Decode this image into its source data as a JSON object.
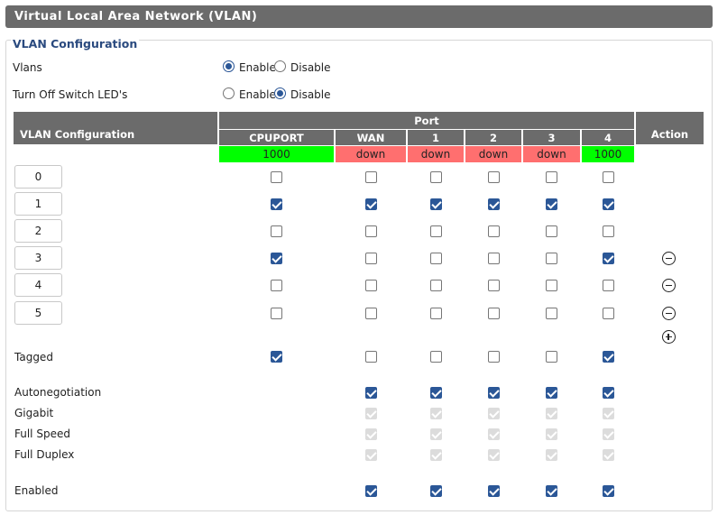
{
  "title": "Virtual Local Area Network (VLAN)",
  "section_legend": "VLAN Configuration",
  "settings": {
    "vlans": {
      "label": "Vlans",
      "enable_label": "Enable",
      "disable_label": "Disable",
      "selected": "enable"
    },
    "leds": {
      "label": "Turn Off Switch LED's",
      "enable_label": "Enable",
      "disable_label": "Disable",
      "selected": "disable"
    }
  },
  "table": {
    "vlan_header": "VLAN Configuration",
    "port_header": "Port",
    "action_header": "Action",
    "ports": [
      {
        "name": "CPUPORT",
        "status": "1000"
      },
      {
        "name": "WAN",
        "status": "down"
      },
      {
        "name": "1",
        "status": "down"
      },
      {
        "name": "2",
        "status": "down"
      },
      {
        "name": "3",
        "status": "down"
      },
      {
        "name": "4",
        "status": "1000"
      }
    ],
    "status_colors": {
      "up": "#00ff00",
      "down": "#ff6f6f"
    },
    "accent": "#2b5797",
    "vlans": [
      {
        "id": "0",
        "members": [
          false,
          false,
          false,
          false,
          false,
          false
        ],
        "removable": false
      },
      {
        "id": "1",
        "members": [
          true,
          true,
          true,
          true,
          true,
          true
        ],
        "removable": false
      },
      {
        "id": "2",
        "members": [
          false,
          false,
          false,
          false,
          false,
          false
        ],
        "removable": false
      },
      {
        "id": "3",
        "members": [
          true,
          false,
          false,
          false,
          false,
          true
        ],
        "removable": true
      },
      {
        "id": "4",
        "members": [
          false,
          false,
          false,
          false,
          false,
          false
        ],
        "removable": true
      },
      {
        "id": "5",
        "members": [
          false,
          false,
          false,
          false,
          false,
          false
        ],
        "removable": true
      }
    ],
    "add_icon": "plus-circle-icon",
    "remove_icon": "minus-circle-icon",
    "tagged": {
      "label": "Tagged",
      "values": [
        true,
        false,
        false,
        false,
        false,
        true
      ]
    },
    "port_options": [
      {
        "label": "Autonegotiation",
        "values": [
          null,
          true,
          true,
          true,
          true,
          true
        ],
        "disabled": false
      },
      {
        "label": "Gigabit",
        "values": [
          null,
          true,
          true,
          true,
          true,
          true
        ],
        "disabled": true
      },
      {
        "label": "Full Speed",
        "values": [
          null,
          true,
          true,
          true,
          true,
          true
        ],
        "disabled": true
      },
      {
        "label": "Full Duplex",
        "values": [
          null,
          true,
          true,
          true,
          true,
          true
        ],
        "disabled": true
      },
      {
        "label": "Enabled",
        "values": [
          null,
          true,
          true,
          true,
          true,
          true
        ],
        "disabled": false
      }
    ]
  }
}
